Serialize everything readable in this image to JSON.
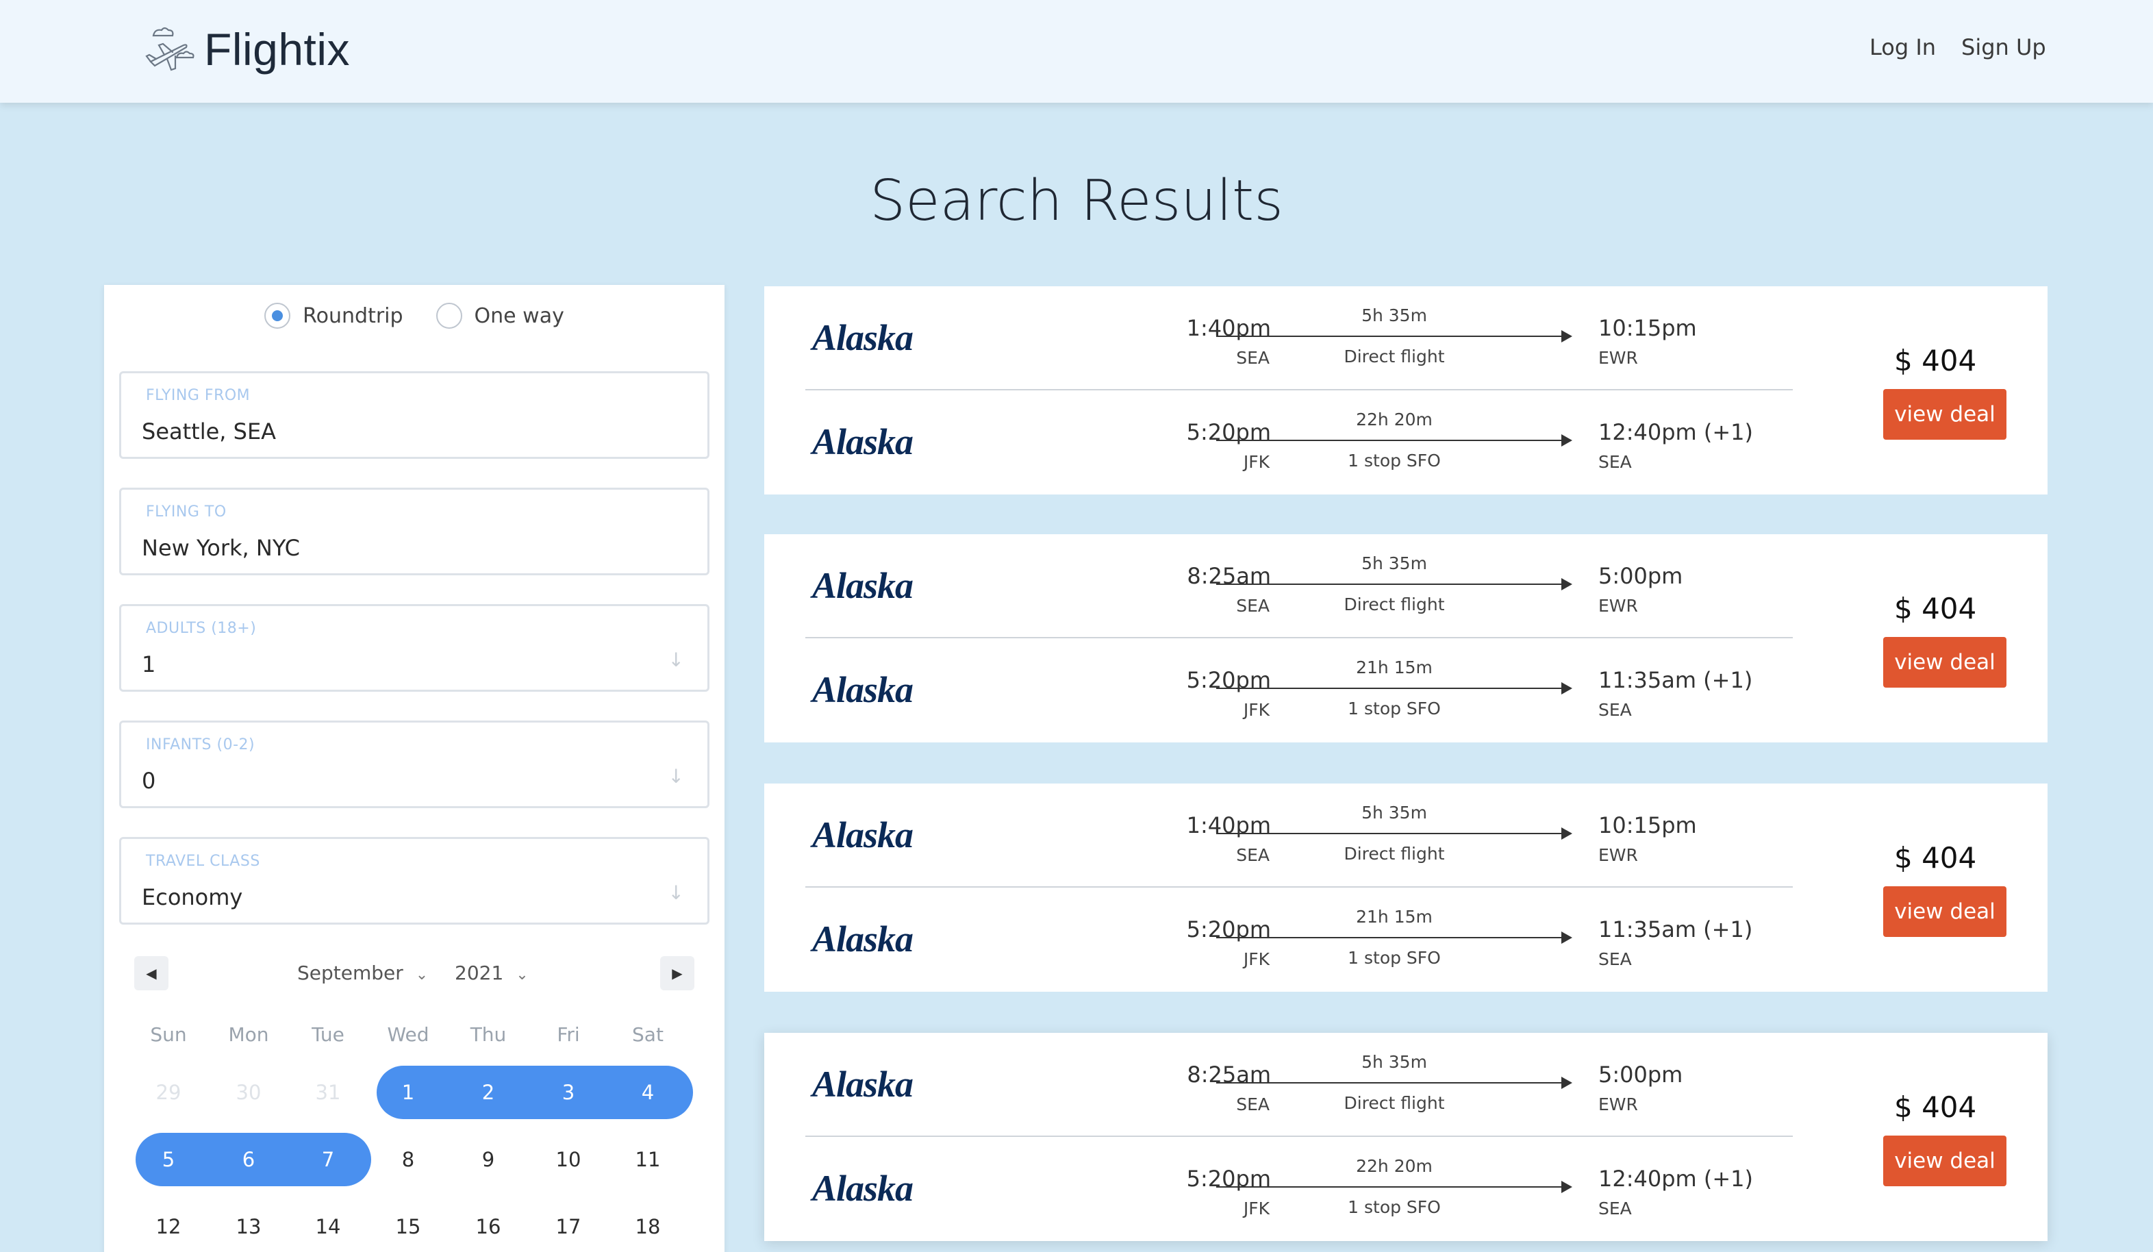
{
  "header": {
    "brand": "Flightix",
    "login_label": "Log In",
    "signup_label": "Sign Up"
  },
  "page_title": "Search Results",
  "search": {
    "trip_types": [
      {
        "label": "Roundtrip",
        "checked": true
      },
      {
        "label": "One way",
        "checked": false
      }
    ],
    "from": {
      "label": "FLYING FROM",
      "value": "Seattle, SEA"
    },
    "to": {
      "label": "FLYING TO",
      "value": "New York, NYC"
    },
    "adults": {
      "label": "ADULTS (18+)",
      "value": "1"
    },
    "infants": {
      "label": "INFANTS (0-2)",
      "value": "0"
    },
    "travel_class": {
      "label": "TRAVEL CLASS",
      "value": "Economy"
    }
  },
  "calendar": {
    "month": "September",
    "year": "2021",
    "weekdays": [
      "Sun",
      "Mon",
      "Tue",
      "Wed",
      "Thu",
      "Fri",
      "Sat"
    ],
    "weeks": [
      [
        "29",
        "30",
        "31",
        "1",
        "2",
        "3",
        "4"
      ],
      [
        "5",
        "6",
        "7",
        "8",
        "9",
        "10",
        "11"
      ],
      [
        "12",
        "13",
        "14",
        "15",
        "16",
        "17",
        "18"
      ]
    ]
  },
  "results": [
    {
      "airline": "Alaska",
      "price": "$ 404",
      "button_label": "view deal",
      "outbound": {
        "dep_time": "1:40pm",
        "dep_code": "SEA",
        "duration": "5h 35m",
        "stops": "Direct flight",
        "arr_time": "10:15pm",
        "arr_code": "EWR"
      },
      "return": {
        "dep_time": "5:20pm",
        "dep_code": "JFK",
        "duration": "22h 20m",
        "stops": "1 stop SFO",
        "arr_time": "12:40pm (+1)",
        "arr_code": "SEA"
      }
    },
    {
      "airline": "Alaska",
      "price": "$ 404",
      "button_label": "view deal",
      "outbound": {
        "dep_time": "8:25am",
        "dep_code": "SEA",
        "duration": "5h 35m",
        "stops": "Direct flight",
        "arr_time": "5:00pm",
        "arr_code": "EWR"
      },
      "return": {
        "dep_time": "5:20pm",
        "dep_code": "JFK",
        "duration": "21h 15m",
        "stops": "1 stop SFO",
        "arr_time": "11:35am (+1)",
        "arr_code": "SEA"
      }
    },
    {
      "airline": "Alaska",
      "price": "$ 404",
      "button_label": "view deal",
      "outbound": {
        "dep_time": "1:40pm",
        "dep_code": "SEA",
        "duration": "5h 35m",
        "stops": "Direct flight",
        "arr_time": "10:15pm",
        "arr_code": "EWR"
      },
      "return": {
        "dep_time": "5:20pm",
        "dep_code": "JFK",
        "duration": "21h 15m",
        "stops": "1 stop SFO",
        "arr_time": "11:35am (+1)",
        "arr_code": "SEA"
      }
    },
    {
      "airline": "Alaska",
      "price": "$ 404",
      "button_label": "view deal",
      "outbound": {
        "dep_time": "8:25am",
        "dep_code": "SEA",
        "duration": "5h 35m",
        "stops": "Direct flight",
        "arr_time": "5:00pm",
        "arr_code": "EWR"
      },
      "return": {
        "dep_time": "5:20pm",
        "dep_code": "JFK",
        "duration": "22h 20m",
        "stops": "1 stop SFO",
        "arr_time": "12:40pm (+1)",
        "arr_code": "SEA"
      }
    }
  ]
}
